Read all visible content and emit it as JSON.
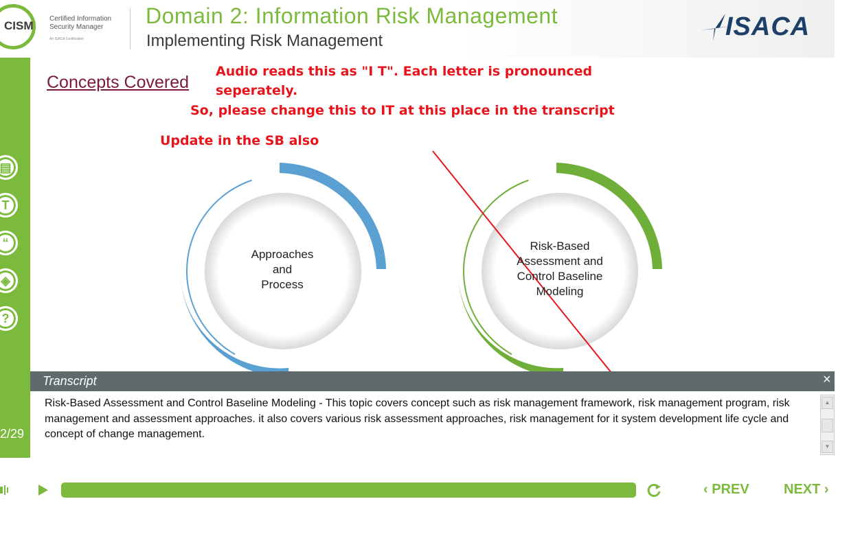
{
  "header": {
    "logo_abbr": "CISM",
    "logo_subtitle_line1": "Certified Information",
    "logo_subtitle_line2": "Security Manager",
    "logo_tagline": "An ISACA Certification",
    "title": "Domain 2: Information Risk Management",
    "subtitle": "Implementing Risk Management",
    "brand": "ISACA"
  },
  "sidebar": {
    "icons": [
      "notes-icon",
      "transcript-icon",
      "quote-icon",
      "layers-icon",
      "help-icon"
    ],
    "icon_glyphs": [
      "▤",
      "T",
      "“",
      "◈",
      "?"
    ],
    "page_counter": "2/29"
  },
  "main": {
    "concepts_heading": "Concepts Covered",
    "circle_left_label": [
      "Approaches",
      "and",
      "Process"
    ],
    "circle_right_label": [
      "Risk-Based",
      "Assessment and",
      "Control Baseline",
      "Modeling"
    ]
  },
  "annotations": {
    "note1": "Audio reads this as \"I T\". Each letter is pronounced seperately.",
    "note2": "So, please change this to IT at this place in the transcript",
    "note3": "Update in the SB also",
    "color": "#e8141c"
  },
  "transcript": {
    "title": "Transcript",
    "close_glyph": "×",
    "text": "Risk-Based Assessment and Control Baseline Modeling - This topic covers concept such as risk management framework, risk management program, risk management and assessment approaches. it also covers various risk assessment approaches, risk management for it system development life cycle and concept of change management."
  },
  "controls": {
    "progress": 1.0,
    "prev_label": "PREV",
    "next_label": "NEXT"
  },
  "colors": {
    "brand_green": "#7cba3e",
    "circle_blue": "#5aa0d2",
    "circle_green": "#6fae39",
    "transcript_bar": "#5e6a6b",
    "heading_maroon": "#7a1a3e"
  }
}
